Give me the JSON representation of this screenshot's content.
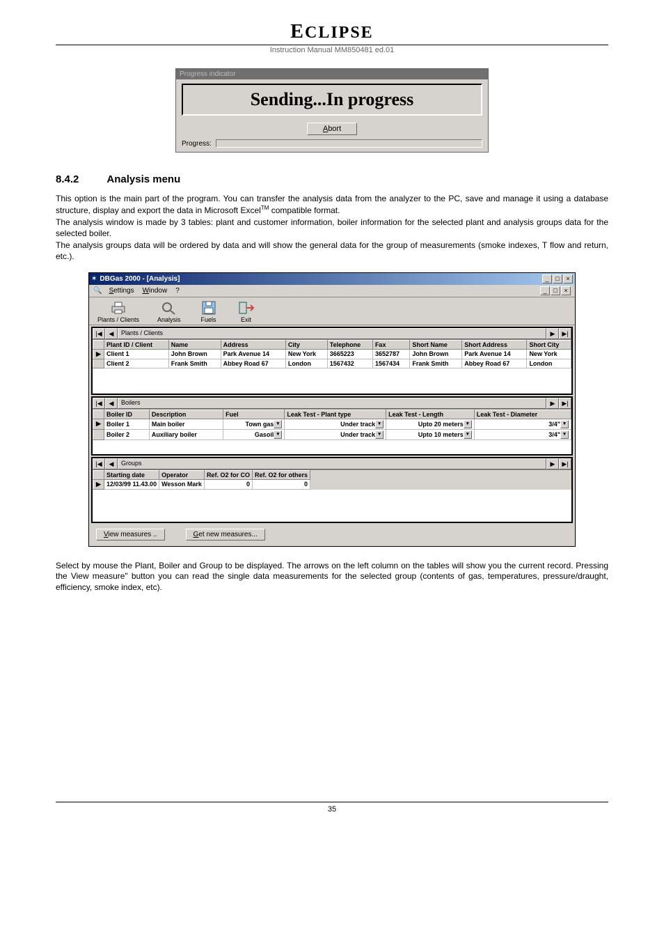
{
  "header": {
    "brand": "ECLIPSE",
    "manual_line": "Instruction Manual MM850481 ed.01"
  },
  "progress_dialog": {
    "title": "Progress indicator",
    "banner": "Sending...In progress",
    "abort_label_pre": "A",
    "abort_label_post": "bort",
    "progress_label": "Progress:"
  },
  "section": {
    "number": "8.4.2",
    "title": "Analysis menu"
  },
  "paragraphs": {
    "p1": "This option is the main part of the program. You can transfer the analysis data from the analyzer to the PC, save and manage it using a database structure, display and export the data in Microsoft Excel",
    "p1_tm": "TM",
    "p1_after": " compatible format.",
    "p2": "The analysis window is made by 3 tables: plant and customer information, boiler information for the selected plant and analysis groups data for the selected boiler.",
    "p3": "The analysis groups data will be ordered by data and will show the general data for the group of measurements (smoke indexes, T flow and return, etc.)."
  },
  "app": {
    "title_main": "DBGas 2000 - [Analysis]",
    "min": "_",
    "max": "□",
    "close": "×",
    "menu": {
      "settings_u": "S",
      "settings_r": "ettings",
      "window_u": "W",
      "window_r": "indow",
      "help": "?"
    },
    "toolbar": {
      "plants": "Plants / Clients",
      "analysis": "Analysis",
      "fuels": "Fuels",
      "exit": "Exit"
    },
    "nav": {
      "first": "|◀",
      "prev": "◀",
      "next": "▶",
      "last": "▶|",
      "label_plants": "Plants / Clients",
      "label_boilers": "Boilers",
      "label_groups": "Groups"
    },
    "plants": {
      "headers": [
        "Plant ID / Client",
        "Name",
        "Address",
        "City",
        "Telephone",
        "Fax",
        "Short Name",
        "Short Address",
        "Short City"
      ],
      "rows": [
        {
          "sel": "▶",
          "cells": [
            "Client 1",
            "John Brown",
            "Park Avenue 14",
            "New York",
            "3665223",
            "3652787",
            "John Brown",
            "Park Avenue 14",
            "New York"
          ]
        },
        {
          "sel": "",
          "cells": [
            "Client 2",
            "Frank Smith",
            "Abbey Road 67",
            "London",
            "1567432",
            "1567434",
            "Frank Smith",
            "Abbey Road 67",
            "London"
          ]
        }
      ]
    },
    "boilers": {
      "headers": [
        "Boiler ID",
        "Description",
        "Fuel",
        "Leak Test - Plant type",
        "Leak Test - Length",
        "Leak Test - Diameter"
      ],
      "rows": [
        {
          "sel": "▶",
          "id": "Boiler 1",
          "desc": "Main boiler",
          "fuel": "Town gas",
          "ptype": "Under track",
          "len": "Upto 20 meters",
          "diam": "3/4\""
        },
        {
          "sel": "",
          "id": "Boiler 2",
          "desc": "Auxiliary boiler",
          "fuel": "Gasoil",
          "ptype": "Under track",
          "len": "Upto 10 meters",
          "diam": "3/4\""
        }
      ]
    },
    "groups": {
      "headers": [
        "Starting date",
        "Operator",
        "Ref. O2 for CO",
        "Ref. O2 for others"
      ],
      "rows": [
        {
          "sel": "▶",
          "cells": [
            "12/03/99 11.43.00",
            "Wesson Mark",
            "0",
            "0"
          ]
        }
      ]
    },
    "buttons": {
      "view_u": "V",
      "view_r": "iew measures ..",
      "get_u": "G",
      "get_r": "et new measures..."
    }
  },
  "paragraph_after": "Select by mouse the Plant, Boiler and Group to be displayed. The arrows on the left column on the tables will show you the current record. Pressing the View measure\" button you can read the single data measurements for the selected group (contents of gas, temperatures, pressure/draught, efficiency, smoke index, etc).",
  "page_number": "35"
}
